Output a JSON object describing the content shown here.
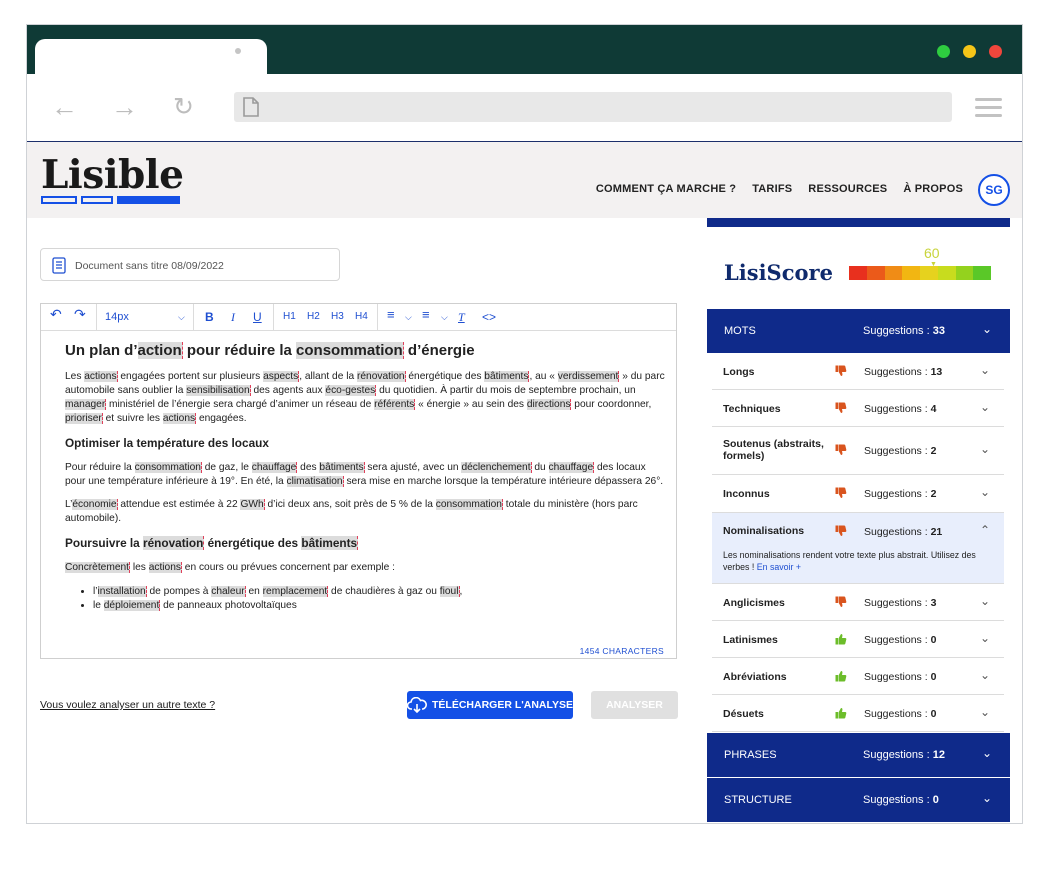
{
  "browser": {
    "colors": {
      "titlebar": "#0f3a36",
      "green": "#2ecc40",
      "yellow": "#f5c518",
      "red": "#f0463c"
    }
  },
  "site": {
    "logo": "Lisible",
    "nav": [
      "COMMENT ÇA MARCHE ?",
      "TARIFS",
      "RESSOURCES",
      "À PROPOS"
    ],
    "avatar": "SG",
    "accent": "#1450e6",
    "navy": "#0f2a8a"
  },
  "document": {
    "title": "Document sans titre 08/09/2022",
    "font_size": "14px",
    "toolbar": {
      "h1": "H1",
      "h2": "H2",
      "h3": "H3",
      "h4": "H4"
    },
    "char_count": "1454 CHARACTERS"
  },
  "actions": {
    "other_text_link": "Vous voulez analyser un autre texte ?",
    "download_button": "TÉLÉCHARGER L'ANALYSE",
    "analyze_button": "ANALYSER"
  },
  "score": {
    "label": "LisiScore",
    "value": "60",
    "value_fraction": 0.6,
    "bar_colors": [
      "#e8301e",
      "#eb5a1a",
      "#f08c16",
      "#f2b612",
      "#e6d21e",
      "#c8dc1e",
      "#94d21e",
      "#5ac828"
    ]
  },
  "analysis": {
    "suggestions_label": "Suggestions :",
    "categories": [
      {
        "name": "MOTS",
        "count": "33"
      },
      {
        "name": "PHRASES",
        "count": "12"
      },
      {
        "name": "STRUCTURE",
        "count": "0"
      }
    ],
    "mots": [
      {
        "name": "Longs",
        "count": "13",
        "status": "bad"
      },
      {
        "name": "Techniques",
        "count": "4",
        "status": "bad"
      },
      {
        "name": "Soutenus (abstraits, formels)",
        "count": "2",
        "status": "bad"
      },
      {
        "name": "Inconnus",
        "count": "2",
        "status": "bad"
      },
      {
        "name": "Nominalisations",
        "count": "21",
        "status": "bad",
        "expanded": true,
        "description": "Les nominalisations rendent votre texte plus abstrait. Utilisez des verbes !",
        "link": "En savoir +"
      },
      {
        "name": "Anglicismes",
        "count": "3",
        "status": "bad"
      },
      {
        "name": "Latinismes",
        "count": "0",
        "status": "good"
      },
      {
        "name": "Abréviations",
        "count": "0",
        "status": "good"
      },
      {
        "name": "Désuets",
        "count": "0",
        "status": "good"
      }
    ]
  }
}
